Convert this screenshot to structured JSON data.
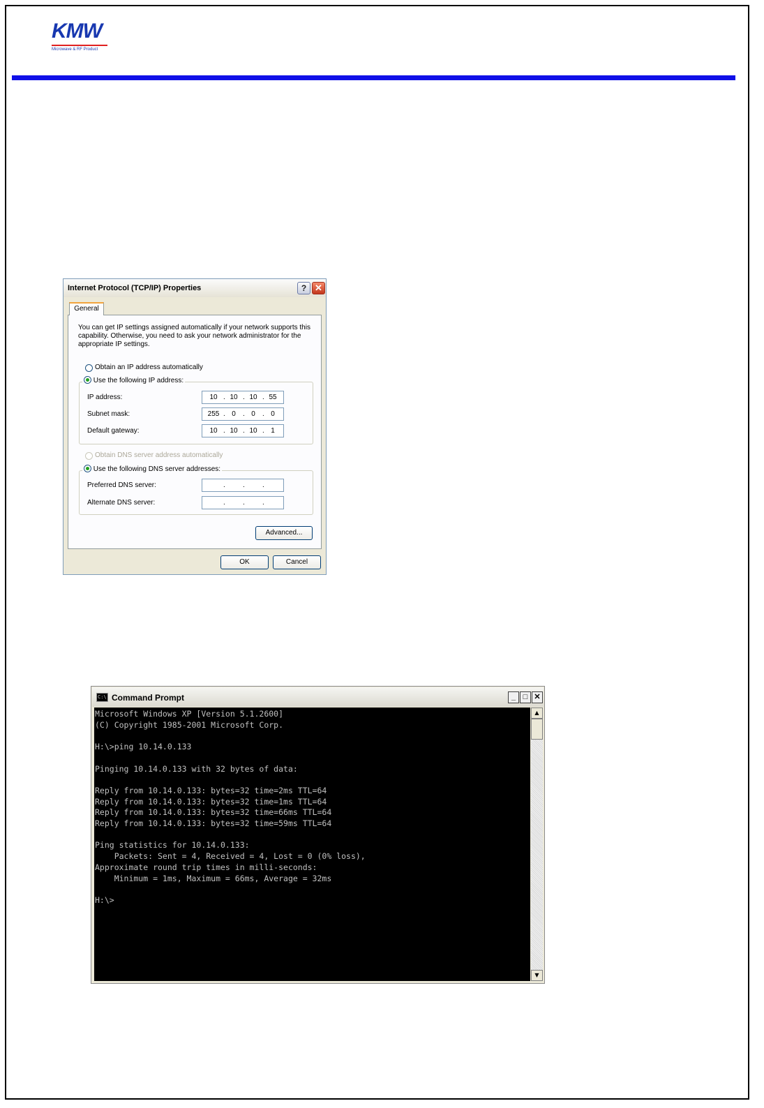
{
  "logo": {
    "text": "KMW",
    "tagline": "Microwave & RF Product"
  },
  "dialog": {
    "title": "Internet Protocol (TCP/IP) Properties",
    "help_glyph": "?",
    "close_glyph": "✕",
    "tab_label": "General",
    "intro_text": "You can get IP settings assigned automatically if your network supports this capability. Otherwise, you need to ask your network administrator for the appropriate IP settings.",
    "ip_options": {
      "auto_label": "Obtain an IP address automatically",
      "manual_label": "Use the following IP address:",
      "selected": "manual"
    },
    "ip_fields": [
      {
        "label": "IP address:",
        "octets": [
          "10",
          "10",
          "10",
          "55"
        ]
      },
      {
        "label": "Subnet mask:",
        "octets": [
          "255",
          "0",
          "0",
          "0"
        ]
      },
      {
        "label": "Default gateway:",
        "octets": [
          "10",
          "10",
          "10",
          "1"
        ]
      }
    ],
    "dns_options": {
      "auto_label": "Obtain DNS server address automatically",
      "manual_label": "Use the following DNS server addresses:",
      "selected": "manual"
    },
    "dns_fields": [
      {
        "label": "Preferred DNS server:",
        "octets": [
          "",
          "",
          "",
          ""
        ]
      },
      {
        "label": "Alternate DNS server:",
        "octets": [
          "",
          "",
          "",
          ""
        ]
      }
    ],
    "advanced_label": "Advanced...",
    "ok_label": "OK",
    "cancel_label": "Cancel",
    "octet_separator": "."
  },
  "console": {
    "title": "Command Prompt",
    "icon_text": "C:\\",
    "minimize_glyph": "_",
    "maximize_glyph": "□",
    "close_glyph": "✕",
    "scroll_up_glyph": "▲",
    "scroll_down_glyph": "▼",
    "lines": [
      "Microsoft Windows XP [Version 5.1.2600]",
      "(C) Copyright 1985-2001 Microsoft Corp.",
      "",
      "H:\\>ping 10.14.0.133",
      "",
      "Pinging 10.14.0.133 with 32 bytes of data:",
      "",
      "Reply from 10.14.0.133: bytes=32 time=2ms TTL=64",
      "Reply from 10.14.0.133: bytes=32 time=1ms TTL=64",
      "Reply from 10.14.0.133: bytes=32 time=66ms TTL=64",
      "Reply from 10.14.0.133: bytes=32 time=59ms TTL=64",
      "",
      "Ping statistics for 10.14.0.133:",
      "    Packets: Sent = 4, Received = 4, Lost = 0 (0% loss),",
      "Approximate round trip times in milli-seconds:",
      "    Minimum = 1ms, Maximum = 66ms, Average = 32ms",
      "",
      "H:\\>"
    ]
  },
  "colors": {
    "header_rule": "#1010e8",
    "logo_blue": "#1838b0",
    "console_background": "#000000",
    "console_text": "#c0c0c0",
    "dialog_face": "#ece9d8"
  }
}
